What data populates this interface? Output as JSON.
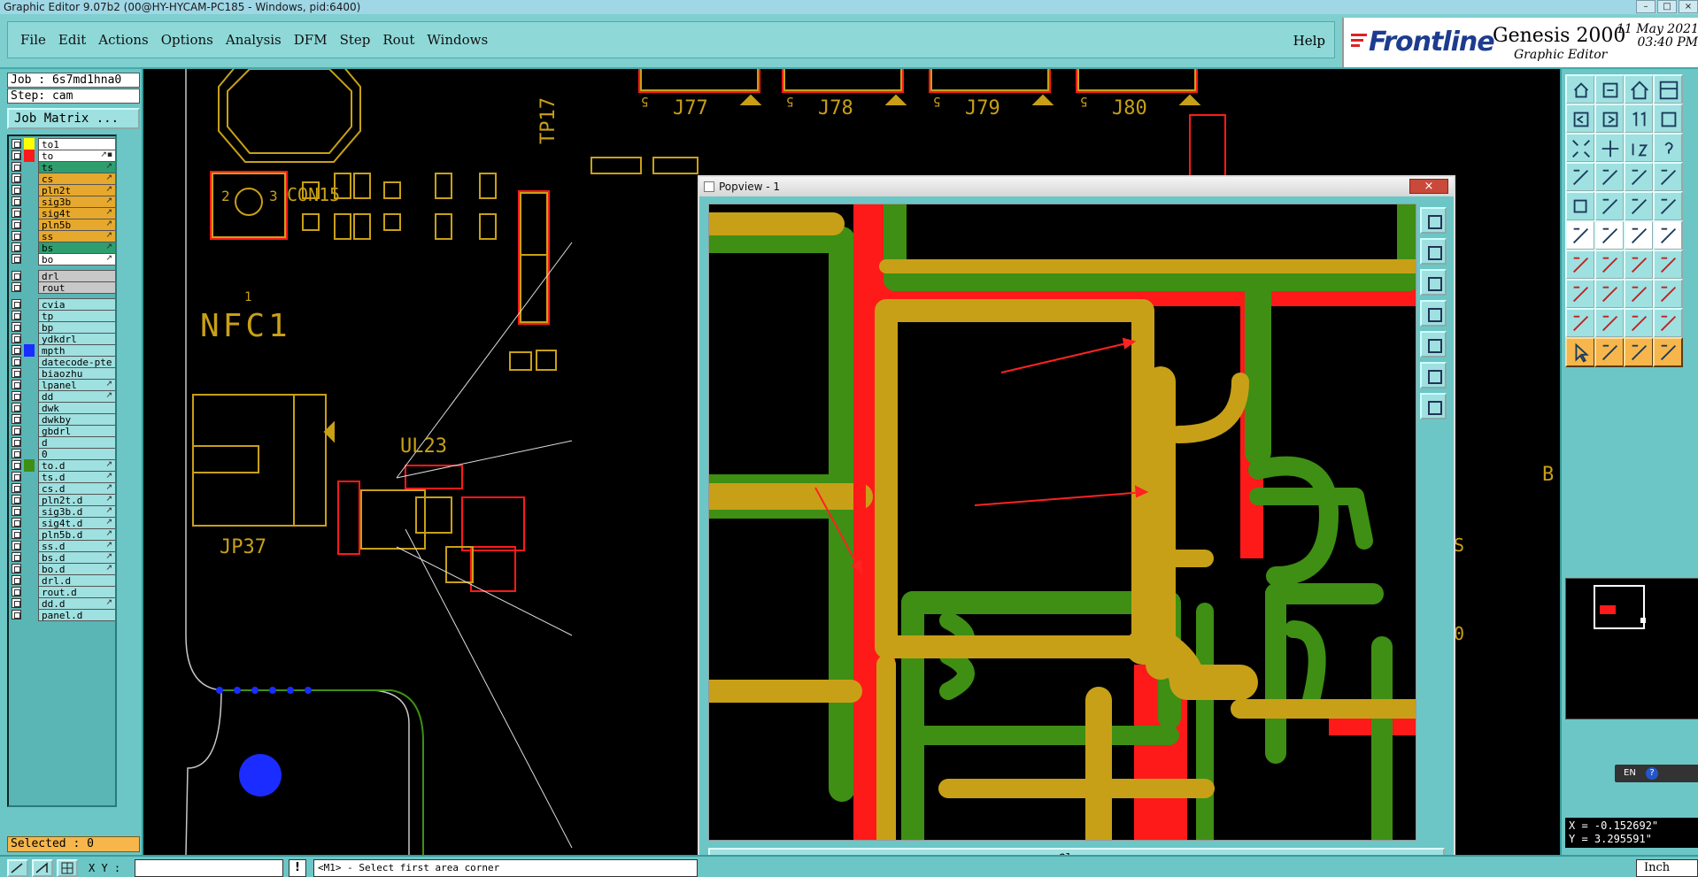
{
  "window": {
    "title": "Graphic Editor 9.07b2 (00@HY-HYCAM-PC185 - Windows, pid:6400)"
  },
  "menu": {
    "items": [
      "File",
      "Edit",
      "Actions",
      "Options",
      "Analysis",
      "DFM",
      "Step",
      "Rout",
      "Windows"
    ],
    "help": "Help"
  },
  "brand": {
    "logo_text": "Frontline",
    "product": "Genesis 2000",
    "subtitle": "Graphic Editor",
    "date": "11 May 2021",
    "time": "03:40 PM"
  },
  "job": {
    "job_label": "Job : 6s7md1hna0",
    "step_label": "Step: cam",
    "matrix_button": "Job Matrix ..."
  },
  "colors": {
    "trace_gold": "#c8a017",
    "copper_red": "#ff1a1a",
    "mask_green": "#3e8f14",
    "blue_pad": "#1a2cff",
    "panel_teal": "#6cc6c6",
    "orange": "#f6b64c"
  },
  "layers": [
    {
      "name": "to1",
      "swatch": "#ffff00",
      "bg": "#ffffff",
      "icon": ""
    },
    {
      "name": "to",
      "swatch": "#ff1a1a",
      "bg": "#ffffff",
      "icon": "↗▪",
      "active": true
    },
    {
      "name": "ts",
      "swatch": "",
      "bg": "#2e9e6e",
      "icon": "↗"
    },
    {
      "name": "cs",
      "swatch": "",
      "bg": "#e6a92e",
      "icon": "↗"
    },
    {
      "name": "pln2t",
      "swatch": "",
      "bg": "#e6a92e",
      "icon": "↗"
    },
    {
      "name": "sig3b",
      "swatch": "",
      "bg": "#e6a92e",
      "icon": "↗"
    },
    {
      "name": "sig4t",
      "swatch": "",
      "bg": "#e6a92e",
      "icon": "↗"
    },
    {
      "name": "pln5b",
      "swatch": "",
      "bg": "#e6a92e",
      "icon": "↗"
    },
    {
      "name": "ss",
      "swatch": "",
      "bg": "#e6a92e",
      "icon": "↗"
    },
    {
      "name": "bs",
      "swatch": "",
      "bg": "#2e9e6e",
      "icon": "↗"
    },
    {
      "name": "bo",
      "swatch": "",
      "bg": "#ffffff",
      "icon": "↗"
    },
    {
      "name": "drl",
      "swatch": "",
      "bg": "#c8c8c8",
      "icon": ""
    },
    {
      "name": "rout",
      "swatch": "",
      "bg": "#c8c8c8",
      "icon": ""
    },
    {
      "name": "cvia",
      "swatch": "",
      "bg": "#9fe0e0",
      "icon": ""
    },
    {
      "name": "tp",
      "swatch": "",
      "bg": "#9fe0e0",
      "icon": ""
    },
    {
      "name": "bp",
      "swatch": "",
      "bg": "#9fe0e0",
      "icon": ""
    },
    {
      "name": "ydkdrl",
      "swatch": "",
      "bg": "#9fe0e0",
      "icon": ""
    },
    {
      "name": "mpth",
      "swatch": "#1a2cff",
      "bg": "#9fe0e0",
      "icon": ""
    },
    {
      "name": "datecode-pte",
      "swatch": "",
      "bg": "#9fe0e0",
      "icon": ""
    },
    {
      "name": "biaozhu",
      "swatch": "",
      "bg": "#9fe0e0",
      "icon": ""
    },
    {
      "name": "lpanel",
      "swatch": "",
      "bg": "#9fe0e0",
      "icon": "↗"
    },
    {
      "name": "dd",
      "swatch": "",
      "bg": "#9fe0e0",
      "icon": "↗"
    },
    {
      "name": "dwk",
      "swatch": "",
      "bg": "#9fe0e0",
      "icon": ""
    },
    {
      "name": "dwkby",
      "swatch": "",
      "bg": "#9fe0e0",
      "icon": ""
    },
    {
      "name": "gbdrl",
      "swatch": "",
      "bg": "#9fe0e0",
      "icon": ""
    },
    {
      "name": "d",
      "swatch": "",
      "bg": "#9fe0e0",
      "icon": ""
    },
    {
      "name": "0",
      "swatch": "",
      "bg": "#9fe0e0",
      "icon": ""
    },
    {
      "name": "to.d",
      "swatch": "#3e8f14",
      "bg": "#9fe0e0",
      "icon": "↗"
    },
    {
      "name": "ts.d",
      "swatch": "",
      "bg": "#9fe0e0",
      "icon": "↗"
    },
    {
      "name": "cs.d",
      "swatch": "",
      "bg": "#9fe0e0",
      "icon": "↗"
    },
    {
      "name": "pln2t.d",
      "swatch": "",
      "bg": "#9fe0e0",
      "icon": "↗"
    },
    {
      "name": "sig3b.d",
      "swatch": "",
      "bg": "#9fe0e0",
      "icon": "↗"
    },
    {
      "name": "sig4t.d",
      "swatch": "",
      "bg": "#9fe0e0",
      "icon": "↗"
    },
    {
      "name": "pln5b.d",
      "swatch": "",
      "bg": "#9fe0e0",
      "icon": "↗"
    },
    {
      "name": "ss.d",
      "swatch": "",
      "bg": "#9fe0e0",
      "icon": "↗"
    },
    {
      "name": "bs.d",
      "swatch": "",
      "bg": "#9fe0e0",
      "icon": "↗"
    },
    {
      "name": "bo.d",
      "swatch": "",
      "bg": "#9fe0e0",
      "icon": "↗"
    },
    {
      "name": "drl.d",
      "swatch": "",
      "bg": "#9fe0e0",
      "icon": ""
    },
    {
      "name": "rout.d",
      "swatch": "",
      "bg": "#9fe0e0",
      "icon": ""
    },
    {
      "name": "dd.d",
      "swatch": "",
      "bg": "#9fe0e0",
      "icon": "↗"
    },
    {
      "name": "panel.d",
      "swatch": "",
      "bg": "#9fe0e0",
      "icon": ""
    }
  ],
  "selected_label": "Selected : 0",
  "canvas_labels": {
    "connectors": [
      "J77",
      "J78",
      "J79",
      "J80"
    ],
    "pin_marks": [
      "5",
      "5",
      "5",
      "5"
    ],
    "con15": "CON15",
    "con15_pins": [
      "2",
      "3",
      "1"
    ],
    "nfc1": "NFC1",
    "ul23": "UL23",
    "jp37": "JP37",
    "tp17": "TP17",
    "right_partial": [
      "B",
      "S",
      "0"
    ]
  },
  "popview": {
    "title": "Popview - 1",
    "close_x": "×",
    "close_button": "Close"
  },
  "right_tools": [
    "zoom-home-icon",
    "zoom-in-icon",
    "home-icon",
    "panel-icon",
    "zoom-left-icon",
    "zoom-right-icon",
    "zoom-1to1-icon",
    "zoom-window-icon",
    "fit-icon",
    "pan-icon",
    "scale-1-2-icon",
    "help-icon",
    "snap-icon",
    "grid-icon",
    "net-icon",
    "layer-icon",
    "select-icon",
    "profile-icon",
    "ruler-icon",
    "pad-icon",
    "connect-icon",
    "cross-icon",
    "arc-icon",
    "via-icon",
    "line-icon",
    "diagonal-icon",
    "round-icon",
    "split-icon",
    "add-pad-icon",
    "measure-icon",
    "align-icon",
    "move-icon",
    "triangle-icon",
    "polygon-icon",
    "arch-icon",
    "bridge-icon",
    "pointer-icon",
    "pointer-select-icon",
    "pointer-zoom-icon",
    "pointer-drag-icon"
  ],
  "ime_label": "EN",
  "coords": {
    "x": "X = -0.152692\"",
    "y": "Y = 3.295591\""
  },
  "status": {
    "xy_label": "X Y :",
    "xy_value": "",
    "excl": "!",
    "message": "<M1> - Select first area corner",
    "units": "Inch"
  }
}
